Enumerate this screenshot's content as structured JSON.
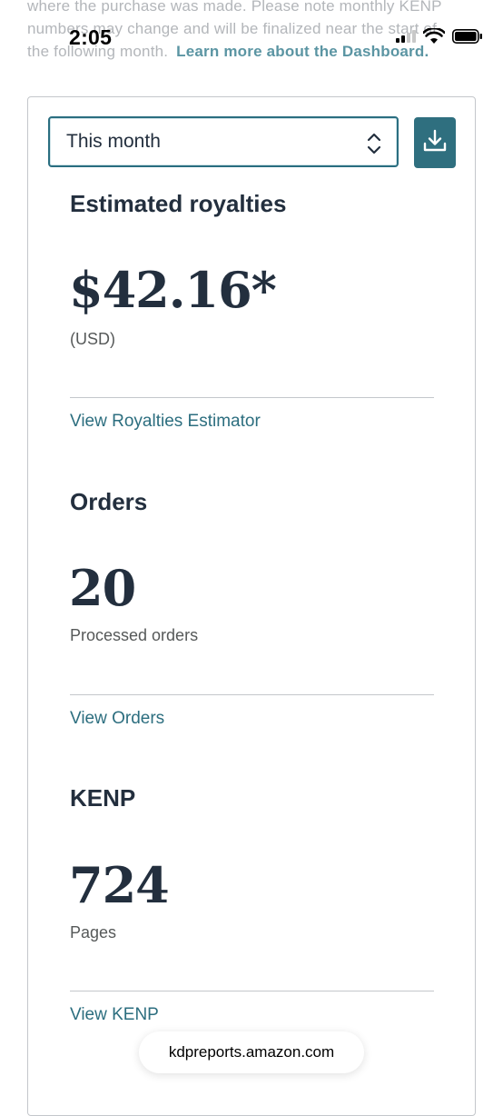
{
  "intro": {
    "line1": "where the purchase was made. Please note monthly KENP",
    "line2": "numbers may change and will be finalized near the start of",
    "line3": "the following month.",
    "learn_more_link": "Learn more about the Dashboard."
  },
  "status_bar": {
    "time": "2:05"
  },
  "filter": {
    "selected": "This month"
  },
  "royalties": {
    "title": "Estimated royalties",
    "value": "$42.16*",
    "currency": "(USD)",
    "link": "View Royalties Estimator"
  },
  "orders": {
    "title": "Orders",
    "value": "20",
    "label": "Processed orders",
    "link": "View Orders"
  },
  "kenp": {
    "title": "KENP",
    "value": "724",
    "label": "Pages",
    "link": "View KENP"
  },
  "browser": {
    "url": "kdpreports.amazon.com"
  },
  "icons": {
    "select": "chevron-up-down-icon",
    "download": "download-icon",
    "signal": "cellular-signal-icon",
    "wifi": "wifi-icon",
    "battery": "battery-icon"
  },
  "colors": {
    "accent": "#2f6f7f",
    "link": "#2c6e7f",
    "text": "#232f3e"
  }
}
